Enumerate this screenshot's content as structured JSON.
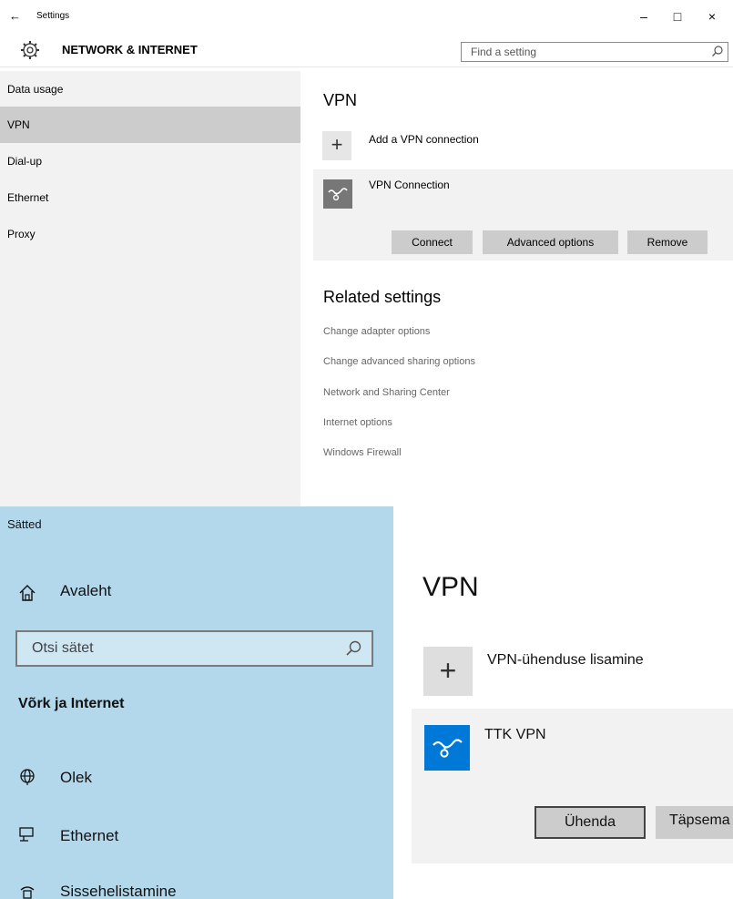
{
  "top": {
    "window": {
      "back": "←",
      "title": "Settings",
      "minimize": "–",
      "maximize": "□",
      "close": "×"
    },
    "header": {
      "title": "NETWORK & INTERNET",
      "search_placeholder": "Find a setting"
    },
    "nav": [
      {
        "label": "Data usage",
        "selected": false
      },
      {
        "label": "VPN",
        "selected": true
      },
      {
        "label": "Dial-up",
        "selected": false
      },
      {
        "label": "Ethernet",
        "selected": false
      },
      {
        "label": "Proxy",
        "selected": false
      }
    ],
    "main": {
      "title": "VPN",
      "add_symbol": "+",
      "add_label": "Add a VPN connection",
      "connection_name": "VPN Connection",
      "buttons": {
        "connect": "Connect",
        "advanced": "Advanced options",
        "remove": "Remove"
      },
      "related_title": "Related settings",
      "related_links": [
        "Change adapter options",
        "Change advanced sharing options",
        "Network and Sharing Center",
        "Internet options",
        "Windows Firewall"
      ]
    }
  },
  "bottom": {
    "app_title": "Sätted",
    "home": "Avaleht",
    "search_placeholder": "Otsi sätet",
    "section": "Võrk ja Internet",
    "nav": [
      "Olek",
      "Ethernet",
      "Sissehelistamine"
    ],
    "main": {
      "title": "VPN",
      "add_symbol": "+",
      "add_label": "VPN-ühenduse lisamine",
      "connection_name": "TTK VPN",
      "buttons": {
        "connect": "Ühenda",
        "advanced": "Täpsema"
      }
    }
  },
  "colors": {
    "nav_bg_top": "#f2f2f2",
    "nav_selected": "#cccccc",
    "nav_bg_bottom": "#b3d8ec",
    "accent": "#0078d7",
    "vpn_icon_gray": "#777777"
  }
}
